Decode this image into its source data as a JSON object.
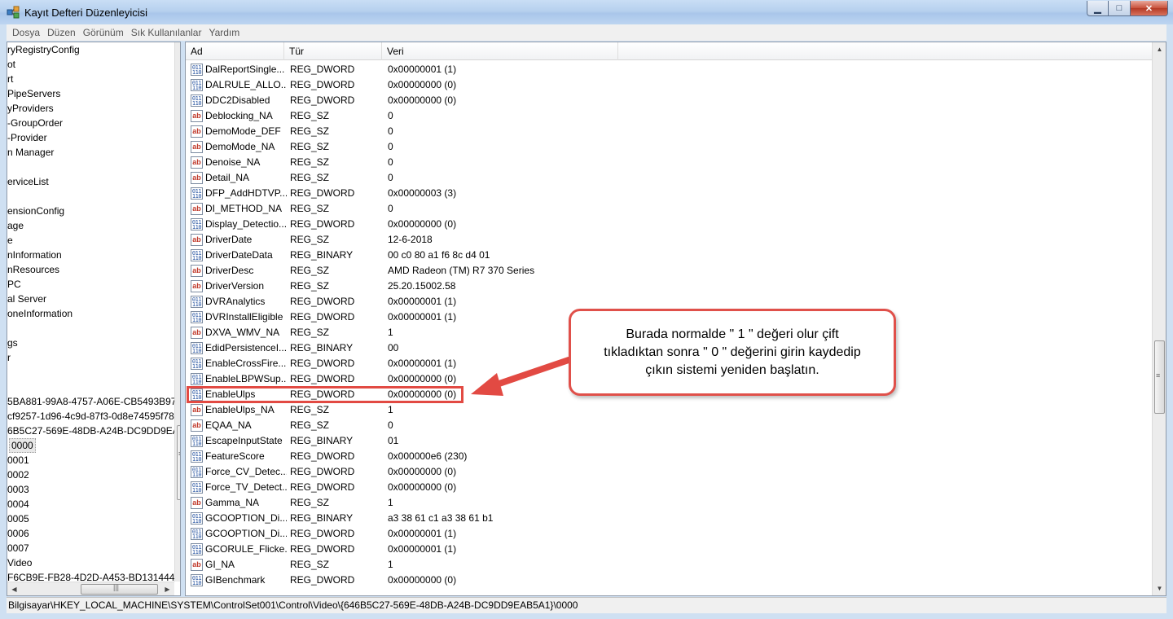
{
  "window": {
    "title": "Kayıt Defteri Düzenleyicisi",
    "min_glyph": "▁",
    "max_glyph": "□",
    "close_glyph": "✕"
  },
  "menu": [
    "Dosya",
    "Düzen",
    "Görünüm",
    "Sık Kullanılanlar",
    "Yardım"
  ],
  "tree": {
    "items": [
      "ryRegistryConfig",
      "ot",
      "rt",
      "PipeServers",
      "yProviders",
      "-GroupOrder",
      "-Provider",
      "n Manager",
      "",
      "erviceList",
      "",
      "ensionConfig",
      "age",
      "e",
      "nInformation",
      "nResources",
      "PC",
      "al Server",
      "oneInformation",
      "",
      "gs",
      "r",
      "",
      "",
      "5BA881-99A8-4757-A06E-CB5493B97...",
      "cf9257-1d96-4c9d-87f3-0d8e74595f78",
      "6B5C27-569E-48DB-A24B-DC9DD9EA...",
      "0000",
      "0001",
      "0002",
      "0003",
      "0004",
      "0005",
      "0006",
      "0007",
      "Video",
      "F6CB9E-FB28-4D2D-A453-BD1314440..."
    ],
    "selected_index": 27
  },
  "columns": {
    "name": "Ad",
    "type": "Tür",
    "data": "Veri"
  },
  "rows": [
    {
      "icon": "bin",
      "name": "DalReportSingle...",
      "type": "REG_DWORD",
      "data": "0x00000001 (1)"
    },
    {
      "icon": "bin",
      "name": "DALRULE_ALLO...",
      "type": "REG_DWORD",
      "data": "0x00000000 (0)"
    },
    {
      "icon": "bin",
      "name": "DDC2Disabled",
      "type": "REG_DWORD",
      "data": "0x00000000 (0)"
    },
    {
      "icon": "sz",
      "name": "Deblocking_NA",
      "type": "REG_SZ",
      "data": "0"
    },
    {
      "icon": "sz",
      "name": "DemoMode_DEF",
      "type": "REG_SZ",
      "data": "0"
    },
    {
      "icon": "sz",
      "name": "DemoMode_NA",
      "type": "REG_SZ",
      "data": "0"
    },
    {
      "icon": "sz",
      "name": "Denoise_NA",
      "type": "REG_SZ",
      "data": "0"
    },
    {
      "icon": "sz",
      "name": "Detail_NA",
      "type": "REG_SZ",
      "data": "0"
    },
    {
      "icon": "bin",
      "name": "DFP_AddHDTVP...",
      "type": "REG_DWORD",
      "data": "0x00000003 (3)"
    },
    {
      "icon": "sz",
      "name": "DI_METHOD_NA",
      "type": "REG_SZ",
      "data": "0"
    },
    {
      "icon": "bin",
      "name": "Display_Detectio...",
      "type": "REG_DWORD",
      "data": "0x00000000 (0)"
    },
    {
      "icon": "sz",
      "name": "DriverDate",
      "type": "REG_SZ",
      "data": "12-6-2018"
    },
    {
      "icon": "bin",
      "name": "DriverDateData",
      "type": "REG_BINARY",
      "data": "00 c0 80 a1 f6 8c d4 01"
    },
    {
      "icon": "sz",
      "name": "DriverDesc",
      "type": "REG_SZ",
      "data": "AMD Radeon (TM) R7 370 Series"
    },
    {
      "icon": "sz",
      "name": "DriverVersion",
      "type": "REG_SZ",
      "data": "25.20.15002.58"
    },
    {
      "icon": "bin",
      "name": "DVRAnalytics",
      "type": "REG_DWORD",
      "data": "0x00000001 (1)"
    },
    {
      "icon": "bin",
      "name": "DVRInstallEligible",
      "type": "REG_DWORD",
      "data": "0x00000001 (1)"
    },
    {
      "icon": "sz",
      "name": "DXVA_WMV_NA",
      "type": "REG_SZ",
      "data": "1"
    },
    {
      "icon": "bin",
      "name": "EdidPersistenceI...",
      "type": "REG_BINARY",
      "data": "00"
    },
    {
      "icon": "bin",
      "name": "EnableCrossFire...",
      "type": "REG_DWORD",
      "data": "0x00000001 (1)"
    },
    {
      "icon": "bin",
      "name": "EnableLBPWSup...",
      "type": "REG_DWORD",
      "data": "0x00000000 (0)"
    },
    {
      "icon": "bin",
      "name": "EnableUlps",
      "type": "REG_DWORD",
      "data": "0x00000000 (0)"
    },
    {
      "icon": "sz",
      "name": "EnableUlps_NA",
      "type": "REG_SZ",
      "data": "1"
    },
    {
      "icon": "sz",
      "name": "EQAA_NA",
      "type": "REG_SZ",
      "data": "0"
    },
    {
      "icon": "bin",
      "name": "EscapeInputState",
      "type": "REG_BINARY",
      "data": "01"
    },
    {
      "icon": "bin",
      "name": "FeatureScore",
      "type": "REG_DWORD",
      "data": "0x000000e6 (230)"
    },
    {
      "icon": "bin",
      "name": "Force_CV_Detec...",
      "type": "REG_DWORD",
      "data": "0x00000000 (0)"
    },
    {
      "icon": "bin",
      "name": "Force_TV_Detect...",
      "type": "REG_DWORD",
      "data": "0x00000000 (0)"
    },
    {
      "icon": "sz",
      "name": "Gamma_NA",
      "type": "REG_SZ",
      "data": "1"
    },
    {
      "icon": "bin",
      "name": "GCOOPTION_Di...",
      "type": "REG_BINARY",
      "data": "a3 38 61 c1 a3 38 61 b1"
    },
    {
      "icon": "bin",
      "name": "GCOOPTION_Di...",
      "type": "REG_DWORD",
      "data": "0x00000001 (1)"
    },
    {
      "icon": "bin",
      "name": "GCORULE_Flicke...",
      "type": "REG_DWORD",
      "data": "0x00000001 (1)"
    },
    {
      "icon": "sz",
      "name": "GI_NA",
      "type": "REG_SZ",
      "data": "1"
    },
    {
      "icon": "bin",
      "name": "GIBenchmark",
      "type": "REG_DWORD",
      "data": "0x00000000 (0)"
    }
  ],
  "icon_text": {
    "sz": "ab",
    "bin": "011 110"
  },
  "highlighted_row_index": 21,
  "callout": {
    "text": "Burada normalde \" 1 \" değeri olur çift tıkladıktan sonra \" 0 \" değerini girin kaydedip çıkın sistemi yeniden başlatın."
  },
  "annotation_color": "#e24a43",
  "statusbar": {
    "path": "Bilgisayar\\HKEY_LOCAL_MACHINE\\SYSTEM\\ControlSet001\\Control\\Video\\{646B5C27-569E-48DB-A24B-DC9DD9EAB5A1}\\0000"
  }
}
